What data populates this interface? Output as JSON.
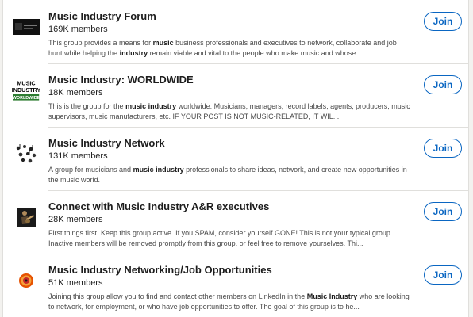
{
  "groups": [
    {
      "title": "Music Industry Forum",
      "members": "169K members",
      "desc": [
        {
          "t": "This group provides a means for "
        },
        {
          "t": "music",
          "b": true
        },
        {
          "t": " business professionals and executives to network, collaborate and job hunt while helping the "
        },
        {
          "t": "industry",
          "b": true
        },
        {
          "t": " remain viable and vital to the people who make music and whose..."
        }
      ],
      "join_label": "Join",
      "logo_icon": "music-industry-forum-logo"
    },
    {
      "title": "Music Industry: WORLDWIDE",
      "members": "18K members",
      "desc": [
        {
          "t": "This is the group for the "
        },
        {
          "t": "music industry",
          "b": true
        },
        {
          "t": " worldwide: Musicians, managers, record labels, agents, producers, music supervisors, music manufacturers, etc. IF YOUR POST IS NOT MUSIC-RELATED, IT WIL..."
        }
      ],
      "join_label": "Join",
      "logo_icon": "music-industry-worldwide-logo",
      "logo_text": [
        "MUSIC",
        "INDUSTRY",
        "WORLDWIDE"
      ]
    },
    {
      "title": "Music Industry Network",
      "members": "131K members",
      "desc": [
        {
          "t": "A group for musicians and "
        },
        {
          "t": "music industry",
          "b": true
        },
        {
          "t": " professionals to share ideas, network, and create new opportunities in the music world."
        }
      ],
      "join_label": "Join",
      "logo_icon": "music-notes-logo"
    },
    {
      "title": "Connect with Music Industry A&R executives",
      "members": "28K members",
      "desc": [
        {
          "t": "First things first. Keep this group active. If you SPAM, consider yourself GONE! This is not your typical group. Inactive members will be removed promptly from this group, or feel free to remove yourselves. Thi..."
        }
      ],
      "join_label": "Join",
      "logo_icon": "guitarist-photo-logo"
    },
    {
      "title": "Music Industry Networking/Job Opportunities",
      "members": "51K members",
      "desc": [
        {
          "t": "Joining this group allow you to find and contact other members on LinkedIn in the "
        },
        {
          "t": "Music Industry",
          "b": true
        },
        {
          "t": " who are looking to network, for employment, or who have job opportunities to offer. The goal of this group is to he..."
        }
      ],
      "join_label": "Join",
      "logo_icon": "vinyl-record-logo"
    }
  ],
  "colors": {
    "accent": "#0a66c2",
    "divider": "#e0dfdc",
    "text_primary": "#1d1d1d",
    "text_secondary": "#4a4a4a"
  }
}
